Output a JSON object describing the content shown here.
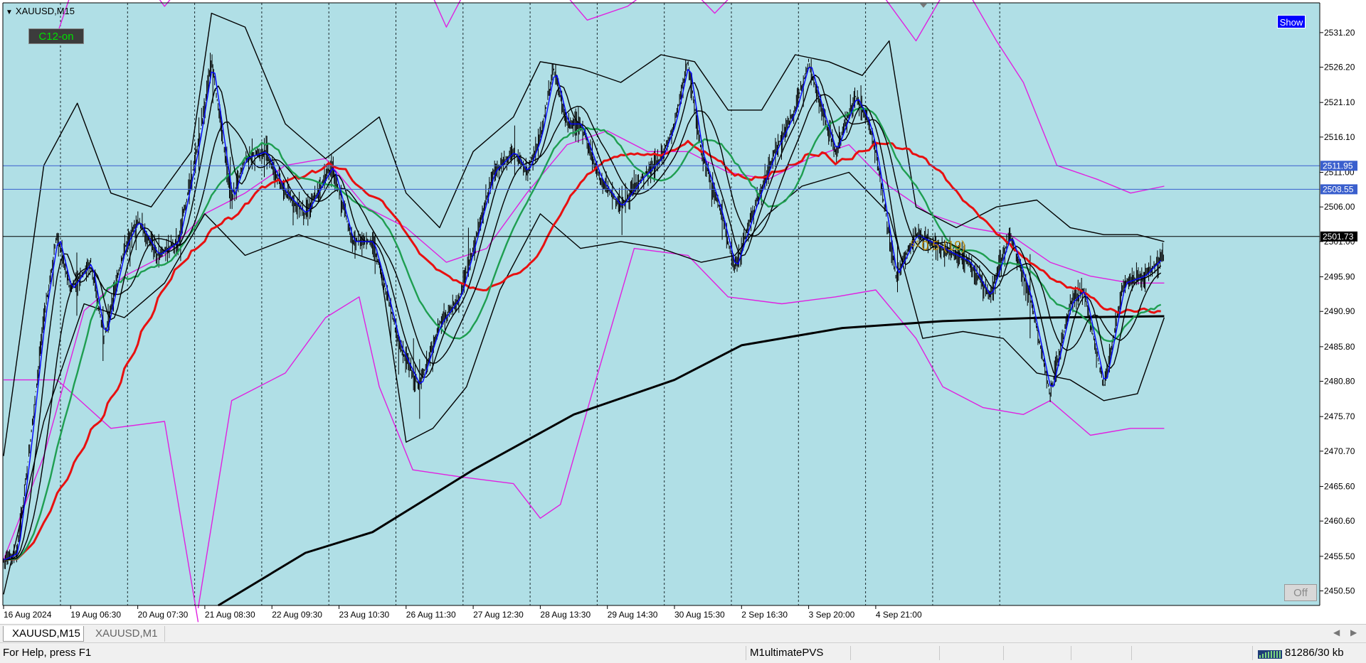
{
  "window": {
    "symbol_title": "XAUUSD,M15",
    "c12_label": "C12-on",
    "show_label": "Show",
    "off_label": "Off",
    "fib_label": "0.5 (19)",
    "fib_tick": "51"
  },
  "chart_data": {
    "type": "candlestick",
    "symbol": "XAUUSD",
    "timeframe": "M15",
    "y_ticks": [
      "2531.20",
      "2526.20",
      "2521.10",
      "2516.10",
      "2511.00",
      "2506.00",
      "2501.00",
      "2495.90",
      "2490.90",
      "2485.80",
      "2480.80",
      "2475.70",
      "2470.70",
      "2465.60",
      "2460.60",
      "2455.50",
      "2450.50"
    ],
    "ylim": [
      2448.4,
      2535.5
    ],
    "x_ticks": [
      "16 Aug 2024",
      "19 Aug 06:30",
      "20 Aug 07:30",
      "21 Aug 08:30",
      "22 Aug 09:30",
      "23 Aug 10:30",
      "26 Aug 11:30",
      "27 Aug 12:30",
      "28 Aug 13:30",
      "29 Aug 14:30",
      "30 Aug 15:30",
      "2 Sep 16:30",
      "3 Sep 20:00",
      "4 Sep 21:00"
    ],
    "horizontal_lines": [
      {
        "price": 2511.95,
        "label": "2511.95",
        "color": "#3a5fcd"
      },
      {
        "price": 2508.55,
        "label": "2508.55",
        "color": "#3a5fcd"
      },
      {
        "price": 2501.73,
        "label": "2501.73",
        "color": "#000000"
      }
    ],
    "price_path": [
      [
        0,
        2455
      ],
      [
        0.2,
        2456
      ],
      [
        0.4,
        2472
      ],
      [
        0.6,
        2490
      ],
      [
        0.8,
        2502
      ],
      [
        1.0,
        2494
      ],
      [
        1.3,
        2498
      ],
      [
        1.5,
        2487
      ],
      [
        1.8,
        2500
      ],
      [
        2.0,
        2504
      ],
      [
        2.3,
        2499
      ],
      [
        2.6,
        2501
      ],
      [
        2.9,
        2515
      ],
      [
        3.1,
        2527
      ],
      [
        3.4,
        2507
      ],
      [
        3.6,
        2513
      ],
      [
        3.9,
        2514
      ],
      [
        4.2,
        2508
      ],
      [
        4.5,
        2505
      ],
      [
        4.9,
        2512
      ],
      [
        5.2,
        2501
      ],
      [
        5.5,
        2501
      ],
      [
        5.7,
        2494
      ],
      [
        5.9,
        2486
      ],
      [
        6.2,
        2480
      ],
      [
        6.5,
        2489
      ],
      [
        6.8,
        2493
      ],
      [
        7.0,
        2500
      ],
      [
        7.3,
        2511
      ],
      [
        7.6,
        2514
      ],
      [
        7.8,
        2511
      ],
      [
        8.0,
        2516
      ],
      [
        8.2,
        2526
      ],
      [
        8.4,
        2518
      ],
      [
        8.6,
        2518
      ],
      [
        8.9,
        2510
      ],
      [
        9.2,
        2506
      ],
      [
        9.5,
        2510
      ],
      [
        9.8,
        2513
      ],
      [
        10.0,
        2518
      ],
      [
        10.2,
        2527
      ],
      [
        10.4,
        2514
      ],
      [
        10.7,
        2505
      ],
      [
        10.9,
        2497
      ],
      [
        11.2,
        2506
      ],
      [
        11.5,
        2514
      ],
      [
        11.8,
        2520
      ],
      [
        12.0,
        2527
      ],
      [
        12.2,
        2520
      ],
      [
        12.4,
        2514
      ],
      [
        12.7,
        2522
      ],
      [
        12.9,
        2518
      ],
      [
        13.0,
        2514
      ],
      [
        13.3,
        2496
      ],
      [
        13.6,
        2502
      ],
      [
        14.0,
        2500
      ],
      [
        14.4,
        2498
      ],
      [
        14.7,
        2493
      ],
      [
        15.0,
        2502
      ],
      [
        15.3,
        2493
      ],
      [
        15.6,
        2479
      ],
      [
        15.9,
        2492
      ],
      [
        16.1,
        2494
      ],
      [
        16.4,
        2480
      ],
      [
        16.7,
        2495
      ],
      [
        17.0,
        2496
      ],
      [
        17.2,
        2498
      ],
      [
        17.3,
        2499
      ]
    ],
    "moving_averages": [
      {
        "color": "#0000ff",
        "lag": 0.05
      },
      {
        "color": "#000000",
        "lag": 0.2
      },
      {
        "color": "#000000",
        "lag": 0.5
      },
      {
        "color": "#1e9e50",
        "lag": 1.0
      },
      {
        "color": "#e81010",
        "lag": 2.0
      }
    ],
    "long_ma": [
      [
        3.2,
        2448.4
      ],
      [
        4.5,
        2456
      ],
      [
        5.5,
        2459
      ],
      [
        7.0,
        2468
      ],
      [
        8.5,
        2476
      ],
      [
        10.0,
        2481
      ],
      [
        11.0,
        2486
      ],
      [
        12.5,
        2488.5
      ],
      [
        14.0,
        2489.5
      ],
      [
        15.5,
        2490
      ],
      [
        17.3,
        2490.2
      ]
    ],
    "magenta_envelope": [
      [
        [
          0,
          2481
        ],
        [
          0.8,
          2481
        ],
        [
          1.6,
          2474
        ],
        [
          2.4,
          2475
        ],
        [
          2.9,
          2446
        ]
      ],
      [
        [
          2.9,
          2448
        ],
        [
          3.4,
          2478
        ],
        [
          4.2,
          2482
        ],
        [
          4.8,
          2490
        ],
        [
          5.3,
          2493
        ],
        [
          5.6,
          2480
        ],
        [
          6.1,
          2468
        ],
        [
          6.8,
          2467
        ],
        [
          7.6,
          2466
        ],
        [
          8.0,
          2461
        ],
        [
          8.3,
          2463
        ],
        [
          8.8,
          2480
        ],
        [
          9.4,
          2500
        ],
        [
          10.2,
          2499
        ],
        [
          10.8,
          2493
        ],
        [
          11.6,
          2492
        ],
        [
          12.4,
          2493
        ],
        [
          13.0,
          2494
        ],
        [
          13.6,
          2487
        ],
        [
          14.0,
          2480
        ],
        [
          14.6,
          2477
        ],
        [
          15.2,
          2476
        ],
        [
          15.6,
          2478
        ],
        [
          16.2,
          2473
        ],
        [
          16.8,
          2474
        ],
        [
          17.3,
          2474
        ]
      ],
      [
        [
          0.8,
          2531
        ],
        [
          1.4,
          2548
        ],
        [
          2.4,
          2535
        ],
        [
          3.0,
          2542
        ],
        [
          3.6,
          2544
        ],
        [
          4.2,
          2542
        ],
        [
          5.0,
          2538
        ],
        [
          5.6,
          2540
        ],
        [
          6.0,
          2545
        ],
        [
          6.6,
          2532
        ],
        [
          7.3,
          2545
        ],
        [
          8.0,
          2541
        ],
        [
          8.7,
          2533
        ],
        [
          9.3,
          2535
        ],
        [
          10.0,
          2540
        ],
        [
          10.6,
          2534
        ],
        [
          11.2,
          2540
        ],
        [
          11.8,
          2538
        ],
        [
          12.4,
          2536
        ],
        [
          13.0,
          2538
        ],
        [
          13.6,
          2530
        ],
        [
          14.2,
          2540
        ],
        [
          14.8,
          2530
        ],
        [
          15.2,
          2524
        ],
        [
          15.7,
          2512
        ],
        [
          16.3,
          2510
        ],
        [
          16.8,
          2508
        ],
        [
          17.3,
          2509
        ]
      ],
      [
        [
          0,
          2455
        ],
        [
          0.6,
          2470
        ],
        [
          1.2,
          2491
        ],
        [
          1.8,
          2496
        ],
        [
          2.4,
          2499
        ],
        [
          3.0,
          2505
        ],
        [
          3.6,
          2508
        ],
        [
          4.2,
          2512
        ],
        [
          4.8,
          2513
        ],
        [
          5.4,
          2506
        ],
        [
          6.0,
          2503
        ],
        [
          6.6,
          2498
        ],
        [
          7.2,
          2500
        ],
        [
          7.8,
          2508
        ],
        [
          8.4,
          2515
        ],
        [
          9.0,
          2517
        ],
        [
          9.6,
          2514
        ],
        [
          10.2,
          2514
        ],
        [
          10.8,
          2511
        ],
        [
          11.4,
          2510
        ],
        [
          12.0,
          2513
        ],
        [
          12.6,
          2515
        ],
        [
          13.2,
          2509
        ],
        [
          13.8,
          2505
        ],
        [
          14.4,
          2503
        ],
        [
          15.0,
          2502
        ],
        [
          15.6,
          2498
        ],
        [
          16.2,
          2496
        ],
        [
          16.8,
          2495
        ],
        [
          17.3,
          2495
        ]
      ]
    ],
    "black_bands": [
      [
        [
          0,
          2470
        ],
        [
          0.6,
          2512
        ],
        [
          1.1,
          2521
        ],
        [
          1.6,
          2508
        ],
        [
          2.2,
          2506
        ],
        [
          2.8,
          2514
        ],
        [
          3.1,
          2534
        ],
        [
          3.6,
          2532
        ],
        [
          4.2,
          2518
        ],
        [
          4.8,
          2513
        ],
        [
          5.2,
          2516
        ],
        [
          5.6,
          2519
        ],
        [
          6.0,
          2508
        ],
        [
          6.5,
          2503
        ],
        [
          7.0,
          2514
        ],
        [
          7.6,
          2519
        ],
        [
          8.0,
          2527
        ],
        [
          8.6,
          2526
        ],
        [
          9.2,
          2524
        ],
        [
          9.8,
          2528
        ],
        [
          10.3,
          2527
        ],
        [
          10.8,
          2520
        ],
        [
          11.3,
          2520
        ],
        [
          11.8,
          2528
        ],
        [
          12.3,
          2527
        ],
        [
          12.8,
          2525
        ],
        [
          13.2,
          2530
        ],
        [
          13.6,
          2506
        ],
        [
          14.2,
          2503
        ],
        [
          14.8,
          2506
        ],
        [
          15.4,
          2507
        ],
        [
          15.9,
          2503
        ],
        [
          16.4,
          2502
        ],
        [
          16.9,
          2502
        ],
        [
          17.3,
          2501
        ]
      ],
      [
        [
          0,
          2450
        ],
        [
          0.6,
          2475
        ],
        [
          1.2,
          2492
        ],
        [
          1.8,
          2490
        ],
        [
          2.4,
          2495
        ],
        [
          3.0,
          2505
        ],
        [
          3.6,
          2499
        ],
        [
          4.4,
          2502
        ],
        [
          5.0,
          2500
        ],
        [
          5.6,
          2498
        ],
        [
          6.0,
          2472
        ],
        [
          6.4,
          2474
        ],
        [
          6.9,
          2480
        ],
        [
          7.4,
          2494
        ],
        [
          8.0,
          2505
        ],
        [
          8.6,
          2500
        ],
        [
          9.2,
          2501
        ],
        [
          9.8,
          2500
        ],
        [
          10.4,
          2498
        ],
        [
          10.9,
          2499
        ],
        [
          11.4,
          2505
        ],
        [
          11.9,
          2509
        ],
        [
          12.6,
          2511
        ],
        [
          13.2,
          2505
        ],
        [
          13.7,
          2487
        ],
        [
          14.3,
          2488
        ],
        [
          14.9,
          2487
        ],
        [
          15.4,
          2482
        ],
        [
          15.9,
          2481
        ],
        [
          16.4,
          2478
        ],
        [
          16.9,
          2479
        ],
        [
          17.3,
          2490
        ]
      ]
    ]
  },
  "tabs": [
    {
      "label": "XAUUSD,M15",
      "active": true
    },
    {
      "label": "XAUUSD,M1",
      "active": false
    }
  ],
  "status": {
    "help": "For Help, press F1",
    "profile": "M1ultimatePVS",
    "traffic": "81286/30 kb"
  },
  "colors": {
    "chart_background": "#b0dfe6",
    "grid": "#1c2a2e",
    "axis_text": "#000000"
  }
}
